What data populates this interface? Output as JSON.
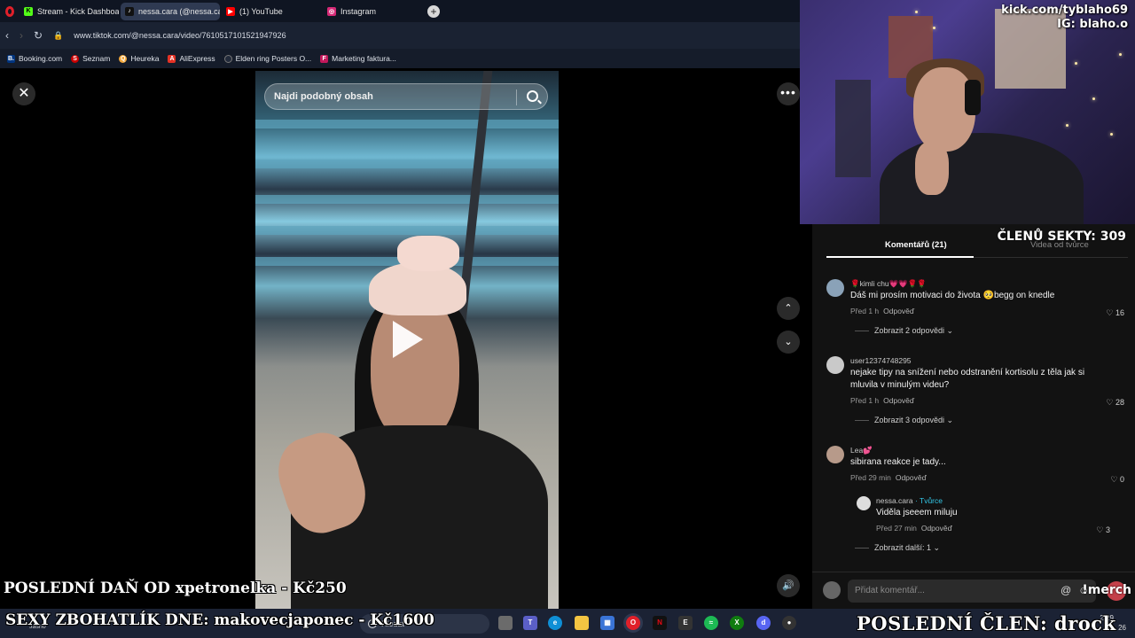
{
  "browser": {
    "tabs": [
      {
        "label": "Stream - Kick Dashboard",
        "icon": "kick-icon",
        "color": "#53fc18"
      },
      {
        "label": "nessa.cara (@nessa.cara) |",
        "icon": "tiktok-icon",
        "color": "#000000"
      },
      {
        "label": "(1) YouTube",
        "icon": "youtube-icon",
        "color": "#ff0000"
      },
      {
        "label": "Instagram",
        "icon": "instagram-icon",
        "color": "#d62976"
      }
    ],
    "url": "www.tiktok.com/@nessa.cara/video/7610517101521947926",
    "bookmarks": [
      {
        "label": "Booking.com",
        "color": "#003580"
      },
      {
        "label": "Seznam",
        "color": "#cc0000"
      },
      {
        "label": "Heureka",
        "color": "#f2a73b"
      },
      {
        "label": "AliExpress",
        "color": "#e43225"
      },
      {
        "label": "Elden ring Posters O...",
        "color": "#222a3a"
      },
      {
        "label": "Marketing faktura...",
        "color": "#c2185b"
      }
    ]
  },
  "video": {
    "search_placeholder": "Najdi podobný obsah",
    "close_glyph": "✕",
    "more_glyph": "•••",
    "up_glyph": "⌃",
    "down_glyph": "⌄",
    "volume_glyph": "🔊"
  },
  "stream": {
    "channel": "kick.com/tyblaho69",
    "instagram": "IG: blaho.o",
    "members_label": "ČLENŮ SEKTY: 309",
    "last_tax": "POSLEDNÍ DAŇ OD xpetronelka - Kč250",
    "top_donor": "SEXY ZBOHATLÍK DNE: makovecjaponec - Kč1600",
    "last_member": "POSLEDNÍ ČLEN: drock",
    "merch": "!merch"
  },
  "comments_panel": {
    "tab_comments": "Komentářů (21)",
    "tab_creator_videos": "Videa od tvůrce",
    "comments": [
      {
        "user": "🌹kimli chu💗💗🌹🌹",
        "text": "Dáš mi prosím motivaci do života 🥺begg on knedle",
        "time": "Před 1 h",
        "reply_label": "Odpověď",
        "likes": "16",
        "replies": "Zobrazit 2 odpovědi ⌄"
      },
      {
        "user": "user12374748295",
        "text": "nejake tipy na snížení nebo odstranění kortisolu z těla jak si mluvila v minulým videu?",
        "time": "Před 1 h",
        "reply_label": "Odpověď",
        "likes": "28",
        "replies": "Zobrazit 3 odpovědi ⌄"
      },
      {
        "user": "Lea💕",
        "text": "sibirana reakce je tady...",
        "time": "Před 29 min",
        "reply_label": "Odpověď",
        "likes": "0"
      }
    ],
    "creator_reply": {
      "user": "nessa.cara",
      "badge": "· Tvůrce",
      "text": "Viděla jseeem miluju",
      "time": "Před 27 min",
      "reply_label": "Odpověď",
      "likes": "3"
    },
    "more_replies": "Zobrazit další: 1 ⌄",
    "input_placeholder": "Přidat komentář...",
    "at_glyph": "@",
    "emoji_glyph": "☺"
  },
  "taskbar": {
    "weather": "Jasno",
    "search_label": "Hledat",
    "time": "2:29",
    "date_fragment": "26",
    "icons": [
      "file-explorer-icon",
      "teams-icon",
      "edge-icon",
      "folder-icon",
      "store-icon",
      "opera-icon",
      "netflix-icon",
      "epic-games-icon",
      "spotify-icon",
      "xbox-icon",
      "discord-icon",
      "obs-icon"
    ]
  }
}
